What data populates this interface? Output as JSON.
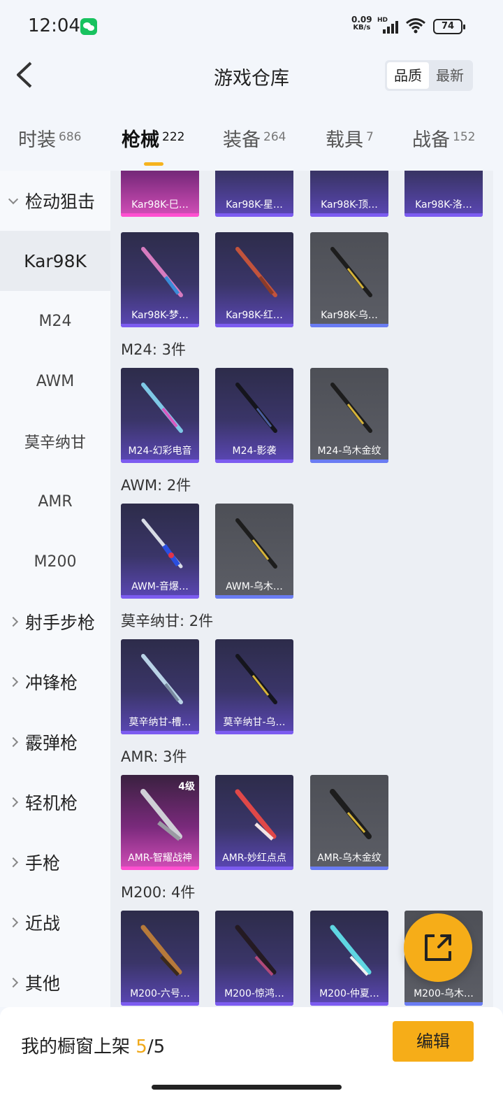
{
  "status_bar": {
    "time": "12:04",
    "net_speed_value": "0.09",
    "net_speed_unit": "KB/s",
    "hd": "HD",
    "battery": "74"
  },
  "header": {
    "title": "游戏仓库",
    "sort_options": [
      "品质",
      "最新"
    ],
    "sort_selected": "品质"
  },
  "tabs": [
    {
      "label": "时装",
      "count": "686"
    },
    {
      "label": "枪械",
      "count": "222",
      "active": true
    },
    {
      "label": "装备",
      "count": "264"
    },
    {
      "label": "载具",
      "count": "7"
    },
    {
      "label": "战备",
      "count": "152"
    }
  ],
  "sidebar": {
    "items": [
      {
        "label": "检动狙击",
        "type": "group-open"
      },
      {
        "label": "Kar98K",
        "type": "sub",
        "active": true
      },
      {
        "label": "M24",
        "type": "sub"
      },
      {
        "label": "AWM",
        "type": "sub"
      },
      {
        "label": "莫辛纳甘",
        "type": "sub"
      },
      {
        "label": "AMR",
        "type": "sub"
      },
      {
        "label": "M200",
        "type": "sub"
      },
      {
        "label": "射手步枪",
        "type": "group"
      },
      {
        "label": "冲锋枪",
        "type": "group"
      },
      {
        "label": "霰弹枪",
        "type": "group"
      },
      {
        "label": "轻机枪",
        "type": "group"
      },
      {
        "label": "手枪",
        "type": "group"
      },
      {
        "label": "近战",
        "type": "group"
      },
      {
        "label": "其他",
        "type": "group"
      }
    ]
  },
  "content": {
    "top_row": [
      "Kar98K-巳…",
      "Kar98K-星…",
      "Kar98K-顶…",
      "Kar98K-洛…"
    ],
    "kar_row": [
      "Kar98K-梦…",
      "Kar98K-红…",
      "Kar98K-乌…"
    ],
    "sections": [
      {
        "label": "M24: 3件",
        "items": [
          "M24-幻彩电音",
          "M24-影袭",
          "M24-乌木金纹"
        ]
      },
      {
        "label": "AWM: 2件",
        "items": [
          "AWM-音爆…",
          "AWM-乌木…"
        ]
      },
      {
        "label": "莫辛纳甘: 2件",
        "items": [
          "莫辛纳甘-槽…",
          "莫辛纳甘-乌…"
        ]
      },
      {
        "label": "AMR: 3件",
        "items": [
          "AMR-智耀战神",
          "AMR-妙红点点",
          "AMR-乌木金纹"
        ],
        "level": "4级"
      },
      {
        "label": "M200: 4件",
        "items": [
          "M200-六号…",
          "M200-惊鸿…",
          "M200-仲夏…",
          "M200-乌木…"
        ]
      }
    ]
  },
  "bottom_bar": {
    "label": "我的橱窗上架",
    "current": "5",
    "total": "/5",
    "edit_label": "编辑"
  },
  "colors": {
    "accent": "#f6ad18",
    "blue_card": "#3a3568",
    "pink_card": "#d54fb9",
    "gray_card": "#5c5e66"
  }
}
